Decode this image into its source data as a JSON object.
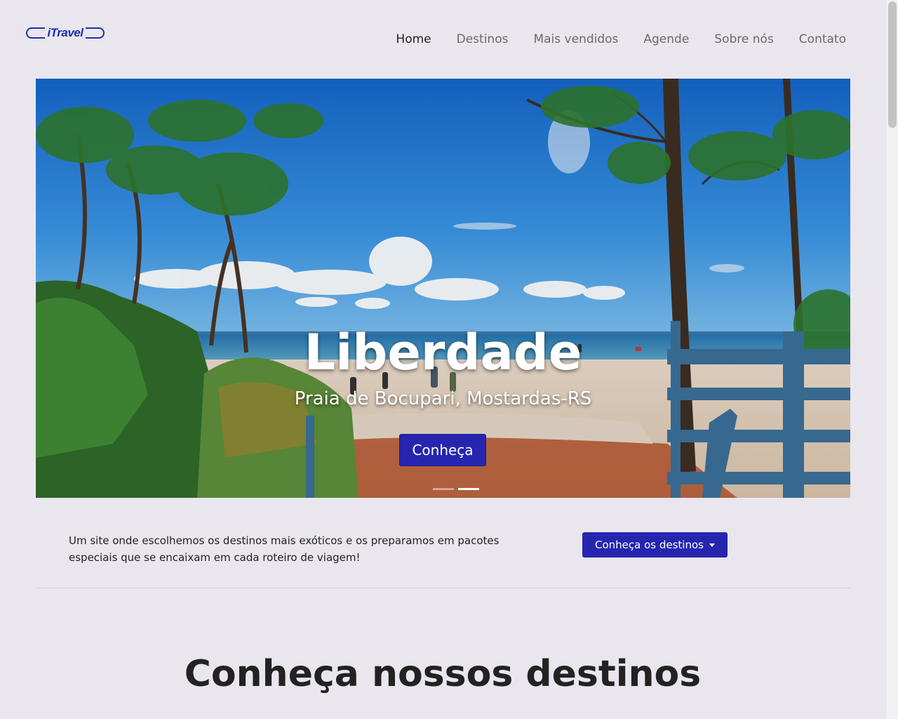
{
  "navbar": {
    "brand": "iTravel",
    "links": [
      {
        "label": "Home",
        "active": true
      },
      {
        "label": "Destinos",
        "active": false
      },
      {
        "label": "Mais vendidos",
        "active": false
      },
      {
        "label": "Agende",
        "active": false
      },
      {
        "label": "Sobre nós",
        "active": false
      },
      {
        "label": "Contato",
        "active": false
      }
    ]
  },
  "hero": {
    "title": "Liberdade",
    "subtitle": "Praia de Bocupari, Mostardas-RS",
    "button_label": "Conheça",
    "slide_count": 2,
    "active_slide": 2
  },
  "intro": {
    "text": "Um site onde escolhemos os destinos mais exóticos e os preparamos em pacotes especiais que se encaixam em cada roteiro de viagem!",
    "dropdown_label": "Conheça os destinos"
  },
  "section": {
    "title": "Conheça nossos destinos"
  },
  "colors": {
    "accent": "#2525b0",
    "brand": "#1d2fb3",
    "background": "#e9e6ee"
  }
}
